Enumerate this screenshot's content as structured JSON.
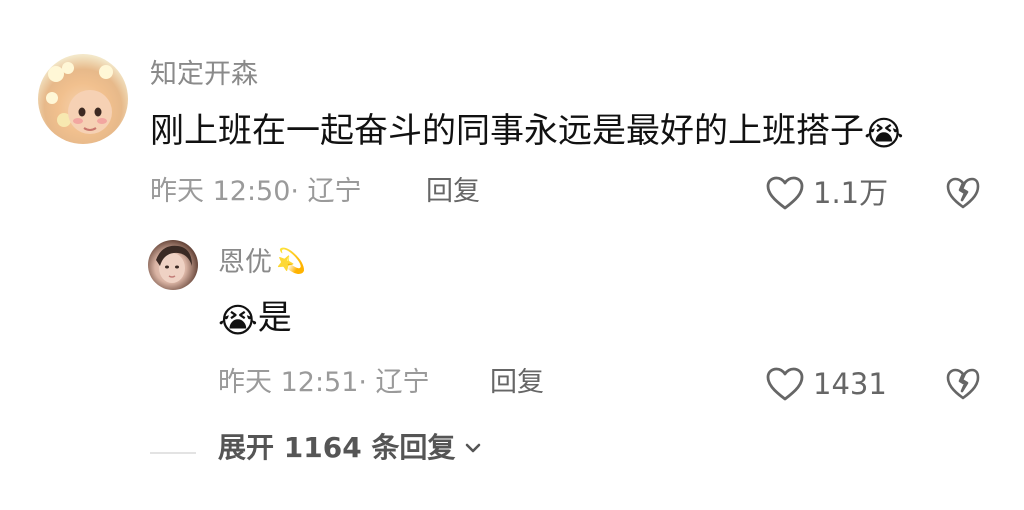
{
  "comment": {
    "username": "知定开森",
    "text": "刚上班在一起奋斗的同事永远是最好的上班搭子",
    "emoji": "😭",
    "meta": "昨天 12:50· 辽宁",
    "reply_label": "回复",
    "likes": "1.1万"
  },
  "reply": {
    "username": "恩优",
    "name_emoji": "💫",
    "emoji": "😭",
    "text": "是",
    "meta": "昨天 12:51· 辽宁",
    "reply_label": "回复",
    "likes": "1431"
  },
  "expand": {
    "label": "展开 1164 条回复"
  },
  "icons": {
    "like": "heart-outline-icon",
    "dislike": "broken-heart-icon",
    "expand": "chevron-down-icon"
  }
}
